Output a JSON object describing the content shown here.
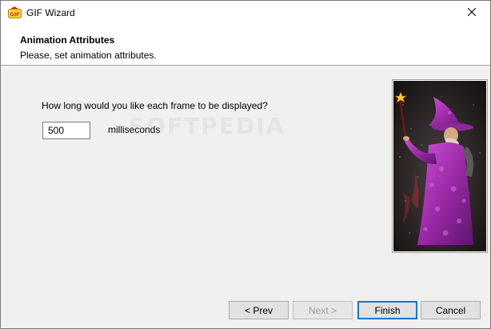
{
  "window": {
    "title": "GIF Wizard",
    "app_icon": "gif-wizard-app-icon",
    "close_icon": "close-icon"
  },
  "header": {
    "title": "Animation Attributes",
    "subtitle": "Please, set animation attributes."
  },
  "form": {
    "question": "How long would you like each frame to be displayed?",
    "duration_value": "500",
    "duration_unit": "milliseconds"
  },
  "watermark": "SOFTPEDIA",
  "image": {
    "description_icon": "wizard-illustration"
  },
  "buttons": {
    "prev": "< Prev",
    "next": "Next >",
    "finish": "Finish",
    "cancel": "Cancel"
  },
  "colors": {
    "accent": "#0078d7",
    "robe": "#b030b8"
  }
}
